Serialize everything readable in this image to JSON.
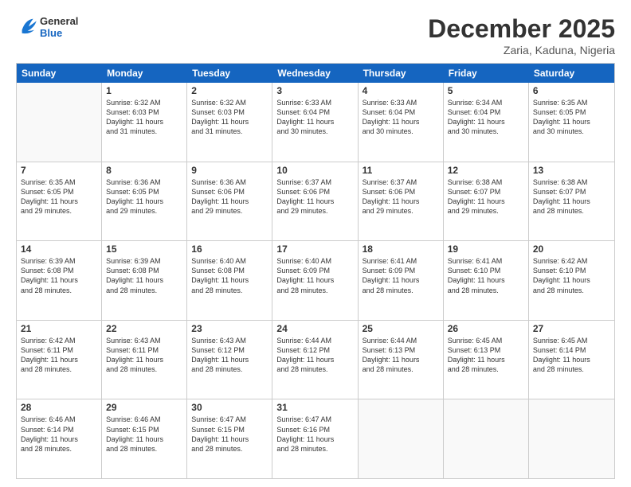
{
  "header": {
    "logo": {
      "general": "General",
      "blue": "Blue"
    },
    "title": "December 2025",
    "subtitle": "Zaria, Kaduna, Nigeria"
  },
  "calendar": {
    "days_of_week": [
      "Sunday",
      "Monday",
      "Tuesday",
      "Wednesday",
      "Thursday",
      "Friday",
      "Saturday"
    ],
    "weeks": [
      [
        {
          "day": "",
          "info": ""
        },
        {
          "day": "1",
          "info": "Sunrise: 6:32 AM\nSunset: 6:03 PM\nDaylight: 11 hours\nand 31 minutes."
        },
        {
          "day": "2",
          "info": "Sunrise: 6:32 AM\nSunset: 6:03 PM\nDaylight: 11 hours\nand 31 minutes."
        },
        {
          "day": "3",
          "info": "Sunrise: 6:33 AM\nSunset: 6:04 PM\nDaylight: 11 hours\nand 30 minutes."
        },
        {
          "day": "4",
          "info": "Sunrise: 6:33 AM\nSunset: 6:04 PM\nDaylight: 11 hours\nand 30 minutes."
        },
        {
          "day": "5",
          "info": "Sunrise: 6:34 AM\nSunset: 6:04 PM\nDaylight: 11 hours\nand 30 minutes."
        },
        {
          "day": "6",
          "info": "Sunrise: 6:35 AM\nSunset: 6:05 PM\nDaylight: 11 hours\nand 30 minutes."
        }
      ],
      [
        {
          "day": "7",
          "info": "Sunrise: 6:35 AM\nSunset: 6:05 PM\nDaylight: 11 hours\nand 29 minutes."
        },
        {
          "day": "8",
          "info": "Sunrise: 6:36 AM\nSunset: 6:05 PM\nDaylight: 11 hours\nand 29 minutes."
        },
        {
          "day": "9",
          "info": "Sunrise: 6:36 AM\nSunset: 6:06 PM\nDaylight: 11 hours\nand 29 minutes."
        },
        {
          "day": "10",
          "info": "Sunrise: 6:37 AM\nSunset: 6:06 PM\nDaylight: 11 hours\nand 29 minutes."
        },
        {
          "day": "11",
          "info": "Sunrise: 6:37 AM\nSunset: 6:06 PM\nDaylight: 11 hours\nand 29 minutes."
        },
        {
          "day": "12",
          "info": "Sunrise: 6:38 AM\nSunset: 6:07 PM\nDaylight: 11 hours\nand 29 minutes."
        },
        {
          "day": "13",
          "info": "Sunrise: 6:38 AM\nSunset: 6:07 PM\nDaylight: 11 hours\nand 28 minutes."
        }
      ],
      [
        {
          "day": "14",
          "info": "Sunrise: 6:39 AM\nSunset: 6:08 PM\nDaylight: 11 hours\nand 28 minutes."
        },
        {
          "day": "15",
          "info": "Sunrise: 6:39 AM\nSunset: 6:08 PM\nDaylight: 11 hours\nand 28 minutes."
        },
        {
          "day": "16",
          "info": "Sunrise: 6:40 AM\nSunset: 6:08 PM\nDaylight: 11 hours\nand 28 minutes."
        },
        {
          "day": "17",
          "info": "Sunrise: 6:40 AM\nSunset: 6:09 PM\nDaylight: 11 hours\nand 28 minutes."
        },
        {
          "day": "18",
          "info": "Sunrise: 6:41 AM\nSunset: 6:09 PM\nDaylight: 11 hours\nand 28 minutes."
        },
        {
          "day": "19",
          "info": "Sunrise: 6:41 AM\nSunset: 6:10 PM\nDaylight: 11 hours\nand 28 minutes."
        },
        {
          "day": "20",
          "info": "Sunrise: 6:42 AM\nSunset: 6:10 PM\nDaylight: 11 hours\nand 28 minutes."
        }
      ],
      [
        {
          "day": "21",
          "info": "Sunrise: 6:42 AM\nSunset: 6:11 PM\nDaylight: 11 hours\nand 28 minutes."
        },
        {
          "day": "22",
          "info": "Sunrise: 6:43 AM\nSunset: 6:11 PM\nDaylight: 11 hours\nand 28 minutes."
        },
        {
          "day": "23",
          "info": "Sunrise: 6:43 AM\nSunset: 6:12 PM\nDaylight: 11 hours\nand 28 minutes."
        },
        {
          "day": "24",
          "info": "Sunrise: 6:44 AM\nSunset: 6:12 PM\nDaylight: 11 hours\nand 28 minutes."
        },
        {
          "day": "25",
          "info": "Sunrise: 6:44 AM\nSunset: 6:13 PM\nDaylight: 11 hours\nand 28 minutes."
        },
        {
          "day": "26",
          "info": "Sunrise: 6:45 AM\nSunset: 6:13 PM\nDaylight: 11 hours\nand 28 minutes."
        },
        {
          "day": "27",
          "info": "Sunrise: 6:45 AM\nSunset: 6:14 PM\nDaylight: 11 hours\nand 28 minutes."
        }
      ],
      [
        {
          "day": "28",
          "info": "Sunrise: 6:46 AM\nSunset: 6:14 PM\nDaylight: 11 hours\nand 28 minutes."
        },
        {
          "day": "29",
          "info": "Sunrise: 6:46 AM\nSunset: 6:15 PM\nDaylight: 11 hours\nand 28 minutes."
        },
        {
          "day": "30",
          "info": "Sunrise: 6:47 AM\nSunset: 6:15 PM\nDaylight: 11 hours\nand 28 minutes."
        },
        {
          "day": "31",
          "info": "Sunrise: 6:47 AM\nSunset: 6:16 PM\nDaylight: 11 hours\nand 28 minutes."
        },
        {
          "day": "",
          "info": ""
        },
        {
          "day": "",
          "info": ""
        },
        {
          "day": "",
          "info": ""
        }
      ]
    ]
  }
}
